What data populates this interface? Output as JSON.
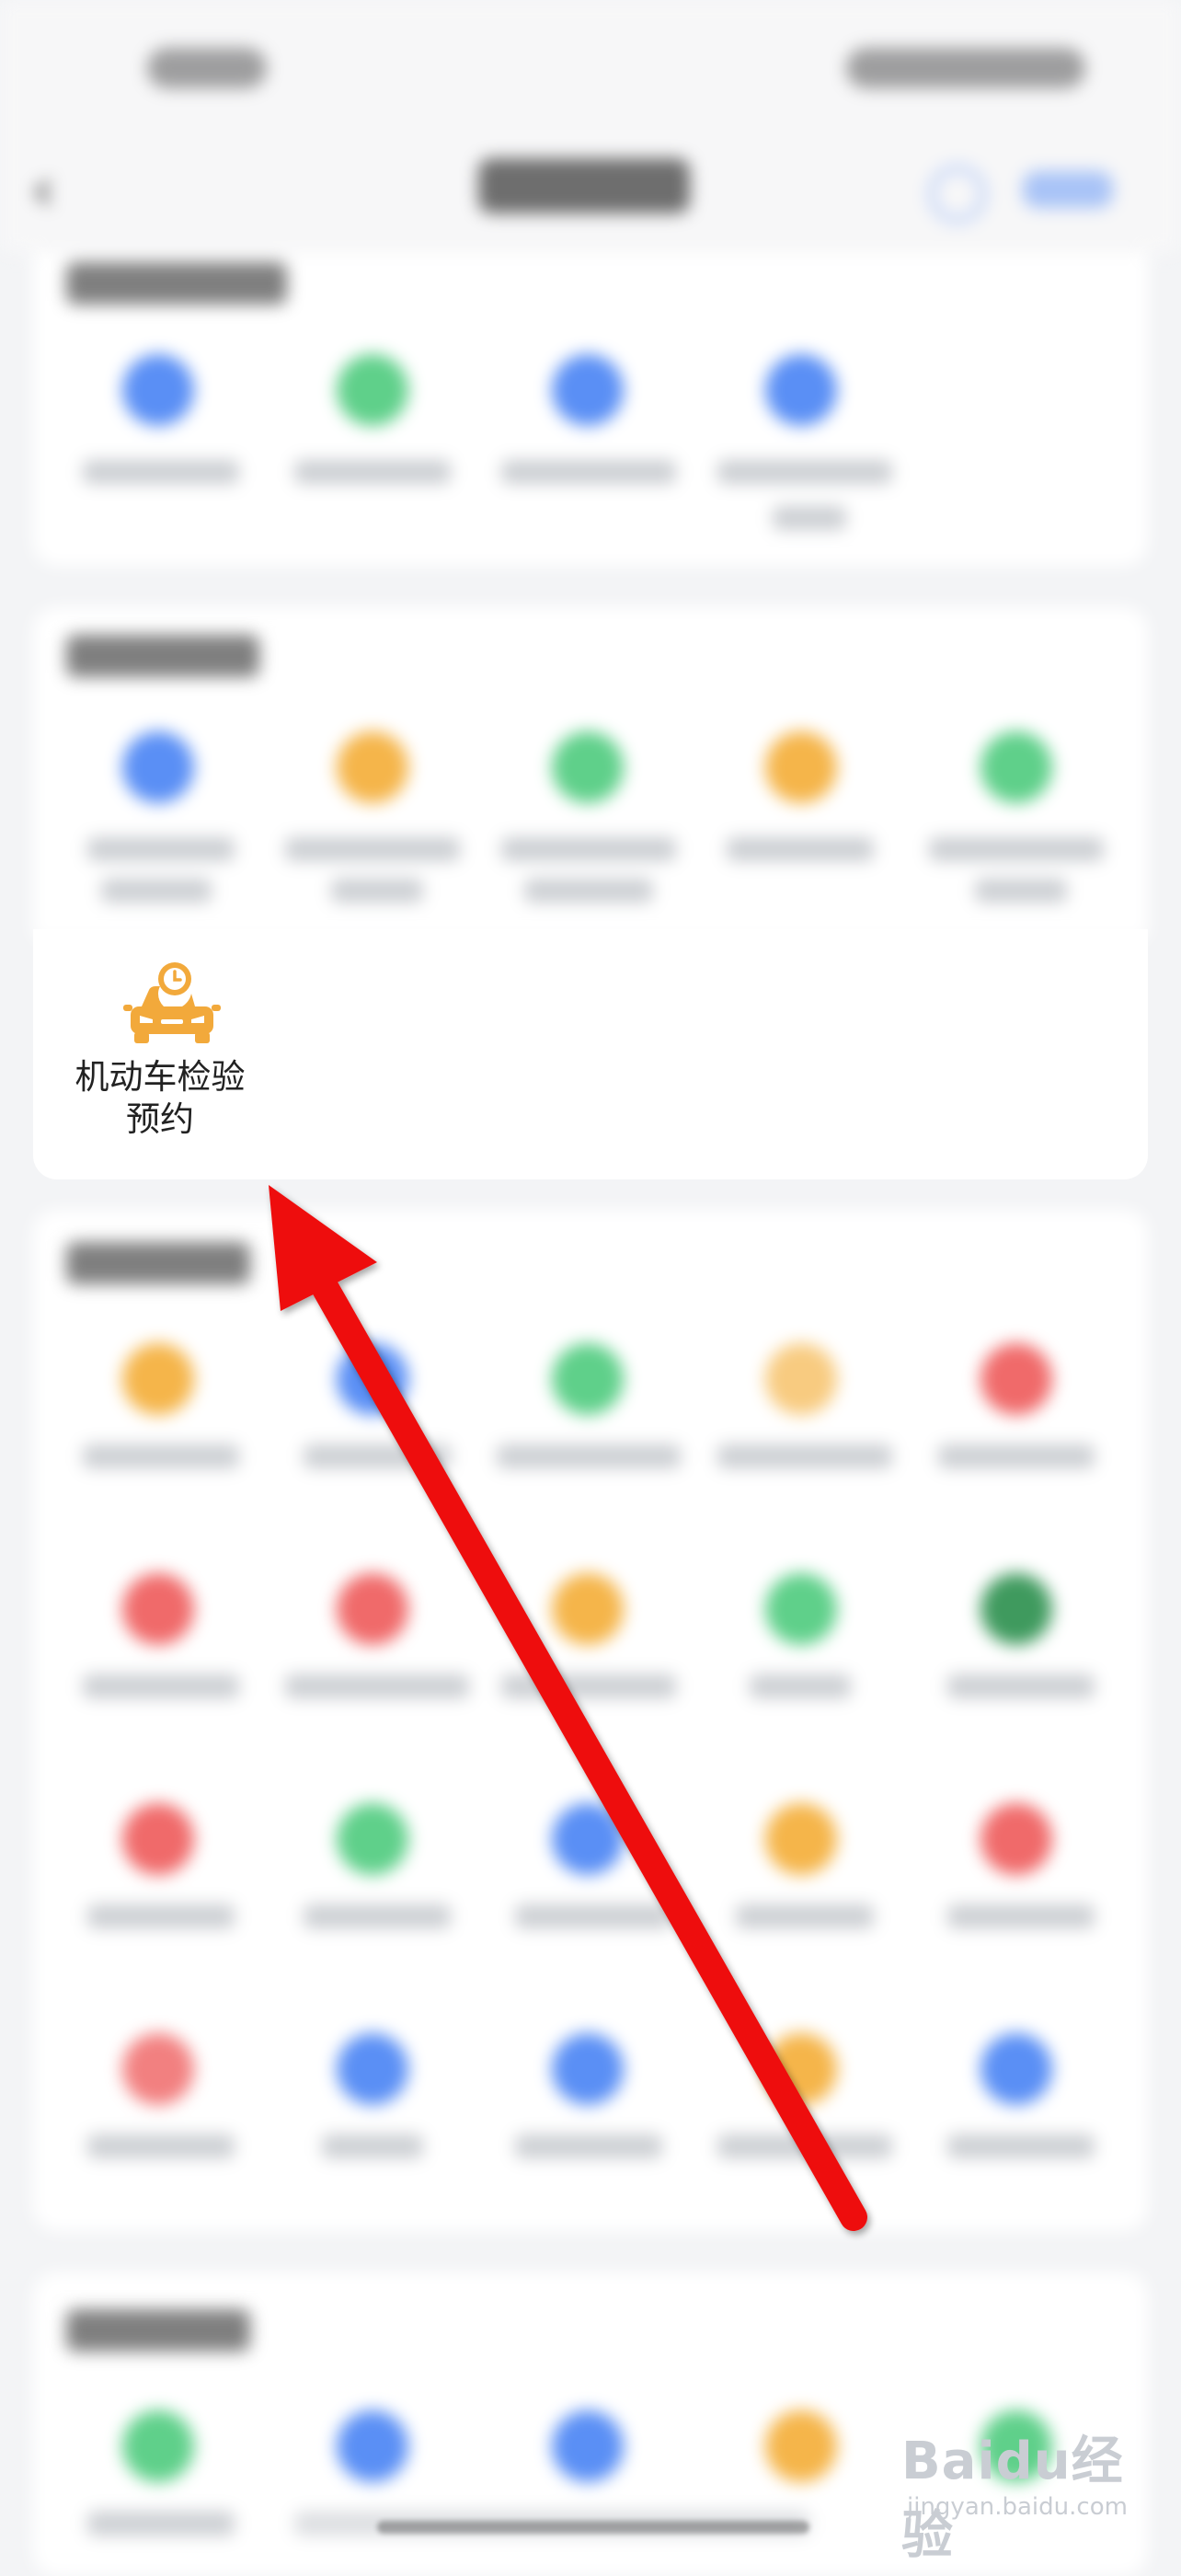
{
  "focused_service": {
    "label": "机动车检验预约",
    "label_line1": "机动车检验",
    "label_line2": "预约",
    "icon": "car-clock-icon",
    "icon_color": "#f2a93b"
  },
  "colors": {
    "blue": "#5a8ff5",
    "green": "#5fd08a",
    "orange": "#f5b54a",
    "red": "#f06a6a",
    "arrow": "#ee1111",
    "background": "#f3f4f6",
    "card": "#ffffff"
  },
  "watermark": {
    "brand": "Baidu经验",
    "domain": "jingyan.baidu.com"
  }
}
